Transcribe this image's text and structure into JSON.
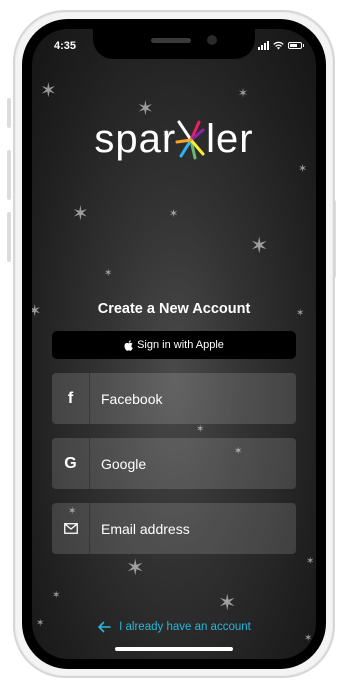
{
  "status_bar": {
    "time": "4:35"
  },
  "brand": {
    "logo_text_left": "spar",
    "logo_text_right": "ler",
    "logo_colors": [
      "#f5a623",
      "#e91e63",
      "#8e24aa",
      "#29b6f6",
      "#66bb6a",
      "#ffeb3b"
    ]
  },
  "screen": {
    "title": "Create a New Account"
  },
  "auth": {
    "apple_label": "Sign in with Apple",
    "facebook_label": "Facebook",
    "google_label": "Google",
    "email_label": "Email address"
  },
  "footer": {
    "login_link": "I already have an account",
    "link_color": "#29b6d9"
  },
  "icons": {
    "apple": "apple-icon",
    "facebook": "facebook-icon",
    "google": "google-icon",
    "email": "envelope-icon",
    "back": "arrow-left-icon"
  }
}
